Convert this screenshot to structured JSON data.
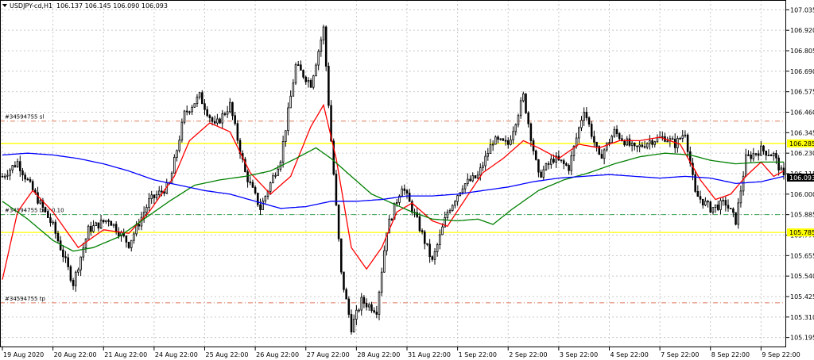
{
  "header": {
    "symbol_label": "USDJPY-cd,H1",
    "ohlc_label": "106.137 106.145 106.090 106.093"
  },
  "colors": {
    "bull": "#000000",
    "bear": "#000000",
    "ma_fast": "#ff0000",
    "ma_mid": "#008000",
    "ma_slow": "#0000ff",
    "hline_yellow": "#ffff00",
    "sl_tp": "#e07a5f",
    "entry": "#3aa655",
    "grid": "#c8c8c8"
  },
  "chart_data": {
    "type": "candlestick",
    "title": "",
    "xlabel": "",
    "ylabel": "",
    "ylim": [
      105.14,
      107.09
    ],
    "y_ticks": [
      "107.035",
      "106.920",
      "106.805",
      "106.690",
      "106.575",
      "106.460",
      "106.345",
      "106.230",
      "106.115",
      "106.000",
      "105.885",
      "105.770",
      "105.655",
      "105.540",
      "105.425",
      "105.310",
      "105.195"
    ],
    "y_tick_values": [
      107.035,
      106.92,
      106.805,
      106.69,
      106.575,
      106.46,
      106.345,
      106.23,
      106.115,
      106.0,
      105.885,
      105.77,
      105.655,
      105.54,
      105.425,
      105.31,
      105.195
    ],
    "x_ticks": [
      "19 Aug 2020",
      "20 Aug 22:00",
      "21 Aug 22:00",
      "24 Aug 22:00",
      "25 Aug 22:00",
      "26 Aug 22:00",
      "27 Aug 22:00",
      "28 Aug 22:00",
      "31 Aug 22:00",
      "1 Sep 22:00",
      "2 Sep 22:00",
      "3 Sep 22:00",
      "4 Sep 22:00",
      "7 Sep 22:00",
      "8 Sep 22:00",
      "9 Sep 22:00"
    ],
    "x_tick_bar_index": [
      0,
      20,
      40,
      60,
      80,
      100,
      120,
      140,
      160,
      180,
      200,
      220,
      240,
      260,
      280,
      300
    ],
    "total_bars": 310,
    "price_path_anchors": [
      {
        "bar": 0,
        "price": 106.1
      },
      {
        "bar": 6,
        "price": 106.18
      },
      {
        "bar": 12,
        "price": 106.02
      },
      {
        "bar": 20,
        "price": 105.82
      },
      {
        "bar": 28,
        "price": 105.5
      },
      {
        "bar": 34,
        "price": 105.8
      },
      {
        "bar": 42,
        "price": 105.86
      },
      {
        "bar": 50,
        "price": 105.72
      },
      {
        "bar": 58,
        "price": 105.96
      },
      {
        "bar": 66,
        "price": 106.05
      },
      {
        "bar": 72,
        "price": 106.45
      },
      {
        "bar": 78,
        "price": 106.55
      },
      {
        "bar": 84,
        "price": 106.38
      },
      {
        "bar": 90,
        "price": 106.5
      },
      {
        "bar": 96,
        "price": 106.12
      },
      {
        "bar": 102,
        "price": 105.92
      },
      {
        "bar": 110,
        "price": 106.2
      },
      {
        "bar": 116,
        "price": 106.72
      },
      {
        "bar": 122,
        "price": 106.62
      },
      {
        "bar": 127,
        "price": 106.93
      },
      {
        "bar": 130,
        "price": 106.3
      },
      {
        "bar": 134,
        "price": 105.55
      },
      {
        "bar": 138,
        "price": 105.25
      },
      {
        "bar": 142,
        "price": 105.4
      },
      {
        "bar": 148,
        "price": 105.35
      },
      {
        "bar": 152,
        "price": 105.8
      },
      {
        "bar": 158,
        "price": 106.05
      },
      {
        "bar": 164,
        "price": 105.85
      },
      {
        "bar": 170,
        "price": 105.62
      },
      {
        "bar": 176,
        "price": 105.9
      },
      {
        "bar": 182,
        "price": 106.05
      },
      {
        "bar": 188,
        "price": 106.1
      },
      {
        "bar": 194,
        "price": 106.3
      },
      {
        "bar": 200,
        "price": 106.28
      },
      {
        "bar": 206,
        "price": 106.55
      },
      {
        "bar": 212,
        "price": 106.1
      },
      {
        "bar": 218,
        "price": 106.2
      },
      {
        "bar": 224,
        "price": 106.15
      },
      {
        "bar": 230,
        "price": 106.48
      },
      {
        "bar": 236,
        "price": 106.2
      },
      {
        "bar": 242,
        "price": 106.35
      },
      {
        "bar": 250,
        "price": 106.25
      },
      {
        "bar": 256,
        "price": 106.3
      },
      {
        "bar": 262,
        "price": 106.32
      },
      {
        "bar": 266,
        "price": 106.28
      },
      {
        "bar": 270,
        "price": 106.35
      },
      {
        "bar": 274,
        "price": 106.0
      },
      {
        "bar": 280,
        "price": 105.92
      },
      {
        "bar": 286,
        "price": 105.95
      },
      {
        "bar": 290,
        "price": 105.85
      },
      {
        "bar": 294,
        "price": 106.2
      },
      {
        "bar": 300,
        "price": 106.25
      },
      {
        "bar": 305,
        "price": 106.22
      },
      {
        "bar": 309,
        "price": 106.09
      }
    ],
    "moving_averages": [
      {
        "color": "red",
        "points": [
          {
            "bar": 0,
            "price": 105.52
          },
          {
            "bar": 6,
            "price": 105.9
          },
          {
            "bar": 12,
            "price": 106.02
          },
          {
            "bar": 20,
            "price": 105.9
          },
          {
            "bar": 30,
            "price": 105.7
          },
          {
            "bar": 40,
            "price": 105.8
          },
          {
            "bar": 50,
            "price": 105.78
          },
          {
            "bar": 58,
            "price": 105.9
          },
          {
            "bar": 68,
            "price": 106.1
          },
          {
            "bar": 74,
            "price": 106.3
          },
          {
            "bar": 82,
            "price": 106.4
          },
          {
            "bar": 90,
            "price": 106.35
          },
          {
            "bar": 98,
            "price": 106.12
          },
          {
            "bar": 106,
            "price": 106.0
          },
          {
            "bar": 114,
            "price": 106.1
          },
          {
            "bar": 122,
            "price": 106.38
          },
          {
            "bar": 127,
            "price": 106.5
          },
          {
            "bar": 132,
            "price": 106.2
          },
          {
            "bar": 138,
            "price": 105.7
          },
          {
            "bar": 144,
            "price": 105.58
          },
          {
            "bar": 150,
            "price": 105.7
          },
          {
            "bar": 156,
            "price": 105.9
          },
          {
            "bar": 162,
            "price": 105.95
          },
          {
            "bar": 170,
            "price": 105.85
          },
          {
            "bar": 176,
            "price": 105.82
          },
          {
            "bar": 182,
            "price": 105.95
          },
          {
            "bar": 190,
            "price": 106.12
          },
          {
            "bar": 198,
            "price": 106.2
          },
          {
            "bar": 206,
            "price": 106.3
          },
          {
            "bar": 212,
            "price": 106.26
          },
          {
            "bar": 220,
            "price": 106.2
          },
          {
            "bar": 228,
            "price": 106.28
          },
          {
            "bar": 236,
            "price": 106.26
          },
          {
            "bar": 244,
            "price": 106.3
          },
          {
            "bar": 252,
            "price": 106.3
          },
          {
            "bar": 260,
            "price": 106.32
          },
          {
            "bar": 268,
            "price": 106.28
          },
          {
            "bar": 276,
            "price": 106.08
          },
          {
            "bar": 282,
            "price": 105.97
          },
          {
            "bar": 288,
            "price": 106.0
          },
          {
            "bar": 294,
            "price": 106.1
          },
          {
            "bar": 300,
            "price": 106.18
          },
          {
            "bar": 305,
            "price": 106.1
          },
          {
            "bar": 309,
            "price": 106.13
          }
        ]
      },
      {
        "color": "green",
        "points": [
          {
            "bar": 0,
            "price": 105.96
          },
          {
            "bar": 10,
            "price": 105.86
          },
          {
            "bar": 20,
            "price": 105.74
          },
          {
            "bar": 28,
            "price": 105.68
          },
          {
            "bar": 36,
            "price": 105.7
          },
          {
            "bar": 46,
            "price": 105.76
          },
          {
            "bar": 56,
            "price": 105.86
          },
          {
            "bar": 66,
            "price": 105.96
          },
          {
            "bar": 76,
            "price": 106.05
          },
          {
            "bar": 86,
            "price": 106.08
          },
          {
            "bar": 96,
            "price": 106.1
          },
          {
            "bar": 106,
            "price": 106.13
          },
          {
            "bar": 116,
            "price": 106.2
          },
          {
            "bar": 124,
            "price": 106.26
          },
          {
            "bar": 130,
            "price": 106.2
          },
          {
            "bar": 138,
            "price": 106.1
          },
          {
            "bar": 146,
            "price": 106.0
          },
          {
            "bar": 154,
            "price": 105.95
          },
          {
            "bar": 162,
            "price": 105.9
          },
          {
            "bar": 170,
            "price": 105.86
          },
          {
            "bar": 180,
            "price": 105.85
          },
          {
            "bar": 188,
            "price": 105.86
          },
          {
            "bar": 194,
            "price": 105.83
          },
          {
            "bar": 202,
            "price": 105.92
          },
          {
            "bar": 212,
            "price": 106.02
          },
          {
            "bar": 222,
            "price": 106.08
          },
          {
            "bar": 232,
            "price": 106.12
          },
          {
            "bar": 242,
            "price": 106.17
          },
          {
            "bar": 252,
            "price": 106.21
          },
          {
            "bar": 262,
            "price": 106.23
          },
          {
            "bar": 272,
            "price": 106.22
          },
          {
            "bar": 280,
            "price": 106.19
          },
          {
            "bar": 290,
            "price": 106.17
          },
          {
            "bar": 300,
            "price": 106.18
          },
          {
            "bar": 309,
            "price": 106.18
          }
        ]
      },
      {
        "color": "blue",
        "points": [
          {
            "bar": 0,
            "price": 106.22
          },
          {
            "bar": 10,
            "price": 106.23
          },
          {
            "bar": 20,
            "price": 106.22
          },
          {
            "bar": 30,
            "price": 106.2
          },
          {
            "bar": 40,
            "price": 106.17
          },
          {
            "bar": 50,
            "price": 106.13
          },
          {
            "bar": 60,
            "price": 106.08
          },
          {
            "bar": 70,
            "price": 106.05
          },
          {
            "bar": 80,
            "price": 106.02
          },
          {
            "bar": 90,
            "price": 106.0
          },
          {
            "bar": 100,
            "price": 105.96
          },
          {
            "bar": 110,
            "price": 105.92
          },
          {
            "bar": 120,
            "price": 105.93
          },
          {
            "bar": 130,
            "price": 105.96
          },
          {
            "bar": 140,
            "price": 105.96
          },
          {
            "bar": 150,
            "price": 105.97
          },
          {
            "bar": 160,
            "price": 105.99
          },
          {
            "bar": 170,
            "price": 105.99
          },
          {
            "bar": 180,
            "price": 106.0
          },
          {
            "bar": 190,
            "price": 106.02
          },
          {
            "bar": 200,
            "price": 106.04
          },
          {
            "bar": 210,
            "price": 106.07
          },
          {
            "bar": 220,
            "price": 106.09
          },
          {
            "bar": 230,
            "price": 106.1
          },
          {
            "bar": 240,
            "price": 106.11
          },
          {
            "bar": 250,
            "price": 106.1
          },
          {
            "bar": 260,
            "price": 106.09
          },
          {
            "bar": 270,
            "price": 106.1
          },
          {
            "bar": 280,
            "price": 106.09
          },
          {
            "bar": 290,
            "price": 106.06
          },
          {
            "bar": 300,
            "price": 106.07
          },
          {
            "bar": 309,
            "price": 106.1
          }
        ]
      }
    ],
    "horizontal_lines": [
      {
        "label": "#34594755 sl",
        "price": 106.41,
        "style": "dashdot",
        "color": "sl_tp"
      },
      {
        "label": "#34594755 buy 0.10",
        "price": 105.885,
        "style": "dashdot",
        "color": "entry"
      },
      {
        "label": "#34594755 tp",
        "price": 105.39,
        "style": "dashdot",
        "color": "sl_tp"
      },
      {
        "label": "",
        "price": 106.285,
        "style": "solid",
        "color": "hline_yellow"
      },
      {
        "label": "",
        "price": 105.785,
        "style": "solid",
        "color": "hline_yellow"
      }
    ],
    "price_markers": [
      {
        "price": 106.285,
        "text": "106.285",
        "bg": "#ffff00",
        "fg": "#000000"
      },
      {
        "price": 106.093,
        "text": "106.093",
        "bg": "#000000",
        "fg": "#ffffff"
      },
      {
        "price": 105.785,
        "text": "105.785",
        "bg": "#ffff00",
        "fg": "#000000"
      }
    ]
  }
}
